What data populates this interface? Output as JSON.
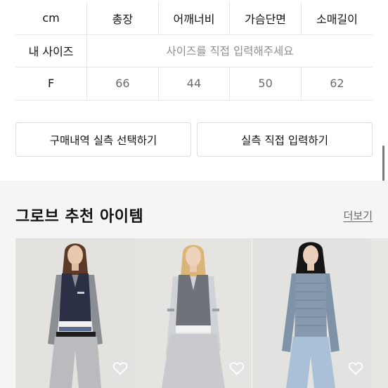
{
  "size_table": {
    "headers": [
      "cm",
      "총장",
      "어깨너비",
      "가슴단면",
      "소매길이"
    ],
    "my_size_label": "내 사이즈",
    "my_size_hint": "사이즈를 직접 입력해주세요",
    "rows": [
      {
        "size": "F",
        "values": [
          "66",
          "44",
          "50",
          "62"
        ]
      }
    ]
  },
  "buttons": {
    "purchase_history": "구매내역 실측 선택하기",
    "direct_input": "실측 직접 입력하기"
  },
  "recommendation": {
    "title": "그로브 추천 아이템",
    "more_label": "더보기",
    "items": [
      {
        "icon": "heart-outline-icon"
      },
      {
        "icon": "heart-outline-icon"
      },
      {
        "icon": "heart-outline-icon"
      }
    ]
  }
}
